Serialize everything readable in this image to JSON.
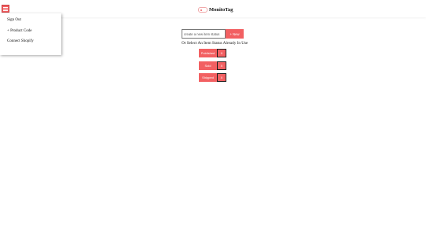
{
  "header": {
    "menu_icon": "hamburger-icon",
    "logo_icon": "toggle-logo-icon",
    "brand_name": "MonitoTag"
  },
  "drawer": {
    "items": [
      {
        "label": "Sign Out"
      },
      {
        "label": "+ Product Code"
      },
      {
        "label": "Connect Shopify"
      }
    ]
  },
  "new_status": {
    "placeholder": "create a new item status",
    "button_label": "+ New"
  },
  "existing": {
    "heading": "Or Select An Item Status Already In Use",
    "statuses": [
      {
        "label": "Published",
        "remove_label": "X"
      },
      {
        "label": "Sold",
        "remove_label": "X"
      },
      {
        "label": "Shipped",
        "remove_label": "X"
      }
    ]
  },
  "colors": {
    "accent": "#f26062",
    "remove_border": "#222222"
  }
}
